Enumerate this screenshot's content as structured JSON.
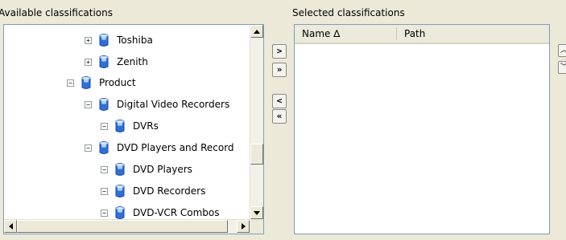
{
  "labels": {
    "available": "Available classifications",
    "selected": "Selected classifications"
  },
  "tree": {
    "items": [
      {
        "label": "Toshiba",
        "expander": "+",
        "icon": "classification-icon"
      },
      {
        "label": "Zenith",
        "expander": "+",
        "icon": "classification-icon"
      },
      {
        "label": "Product",
        "expander": "−",
        "icon": "classification-icon"
      },
      {
        "label": "Digital Video Recorders",
        "expander": "−",
        "icon": "classification-icon"
      },
      {
        "label": "DVRs",
        "expander": "−",
        "icon": "classification-icon"
      },
      {
        "label": "DVD Players and Record",
        "expander": "−",
        "icon": "classification-icon"
      },
      {
        "label": "DVD Players",
        "expander": "−",
        "icon": "classification-icon"
      },
      {
        "label": "DVD Recorders",
        "expander": "−",
        "icon": "classification-icon"
      },
      {
        "label": "DVD-VCR Combos",
        "expander": "−",
        "icon": "classification-icon"
      }
    ]
  },
  "move_buttons": {
    "add": ">",
    "add_all": "»",
    "remove": "<",
    "remove_all": "«"
  },
  "table": {
    "columns": [
      {
        "label": "Name ∆"
      },
      {
        "label": "Path"
      }
    ],
    "rows": []
  },
  "colors": {
    "background": "#ece9d8",
    "border": "#7f9db9",
    "header": "#ebeadb",
    "icon_blue": "#2f6fd6"
  }
}
